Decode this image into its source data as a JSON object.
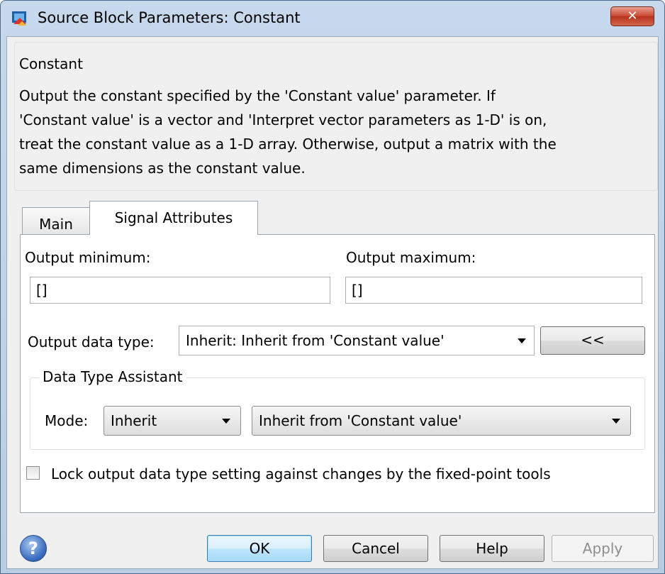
{
  "window": {
    "title": "Source Block Parameters: Constant",
    "close_glyph": "✕"
  },
  "description": {
    "group_label": "Constant",
    "text": "Output the constant specified by the 'Constant value' parameter. If\n'Constant value' is a vector and 'Interpret vector parameters as 1-D' is on,\ntreat the constant value as a 1-D array. Otherwise, output a matrix with the\nsame dimensions as the constant value."
  },
  "tabs": [
    {
      "label": "Main",
      "selected": false
    },
    {
      "label": "Signal Attributes",
      "selected": true
    }
  ],
  "signal_attributes": {
    "output_minimum_label": "Output minimum:",
    "output_minimum_value": "[]",
    "output_maximum_label": "Output maximum:",
    "output_maximum_value": "[]",
    "output_data_type_label": "Output data type:",
    "output_data_type_value": "Inherit: Inherit from 'Constant value'",
    "toggle_assistant_label": "<<",
    "assistant": {
      "group_label": "Data Type Assistant",
      "mode_label": "Mode:",
      "mode_value": "Inherit",
      "inherit_value": "Inherit from 'Constant value'"
    },
    "lock_checkbox_label": "Lock output data type setting against changes by the fixed-point tools",
    "lock_checked": false
  },
  "buttons": {
    "ok": "OK",
    "cancel": "Cancel",
    "help": "Help",
    "apply": "Apply"
  },
  "icons": {
    "app": "simulink-block-icon",
    "help": "help-question-icon",
    "help_glyph": "?"
  },
  "colors": {
    "title_gradient": "#c7d8ec",
    "close_button": "#c8452f",
    "default_button": "#bee6fd"
  }
}
